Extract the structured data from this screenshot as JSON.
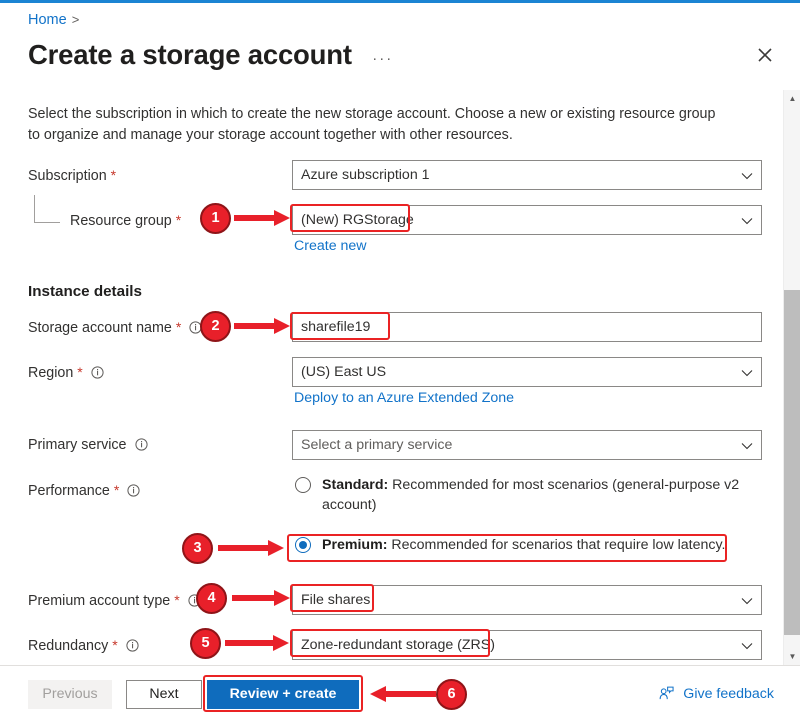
{
  "accent": {
    "blue": "#0f6cbd",
    "link": "#1273c9",
    "red": "#ea2324",
    "required": "#c6372b"
  },
  "breadcrumb": {
    "home": "Home",
    "separator": ">"
  },
  "header": {
    "title": "Create a storage account",
    "more_label": "···",
    "close_icon": "close-icon"
  },
  "description": "Select the subscription in which to create the new storage account. Choose a new or existing resource group to organize and manage your storage account together with other resources.",
  "form": {
    "subscription": {
      "label": "Subscription",
      "required": "*",
      "value": "Azure subscription 1"
    },
    "resource_group": {
      "label": "Resource group",
      "required": "*",
      "value": "(New) RGStorage",
      "create_new_link": "Create new"
    },
    "section_instance_details": "Instance details",
    "storage_account_name": {
      "label": "Storage account name",
      "required": "*",
      "value": "sharefile19"
    },
    "region": {
      "label": "Region",
      "required": "*",
      "value": "(US) East US",
      "extended_zone_link": "Deploy to an Azure Extended Zone"
    },
    "primary_service": {
      "label": "Primary service",
      "placeholder": "Select a primary service",
      "value": "Select a primary service"
    },
    "performance": {
      "label": "Performance",
      "required": "*",
      "options": [
        {
          "name": "Standard",
          "bold": "Standard:",
          "text": " Recommended for most scenarios (general-purpose v2 account)",
          "selected": false
        },
        {
          "name": "Premium",
          "bold": "Premium:",
          "text": " Recommended for scenarios that require low latency.",
          "selected": true
        }
      ]
    },
    "premium_account_type": {
      "label": "Premium account type",
      "required": "*",
      "value": "File shares"
    },
    "redundancy": {
      "label": "Redundancy",
      "required": "*",
      "value": "Zone-redundant storage (ZRS)"
    }
  },
  "footer": {
    "previous": "Previous",
    "next": "Next",
    "review_create": "Review + create",
    "give_feedback": "Give feedback"
  },
  "annotations": [
    {
      "number": "1",
      "target": "resource-group-field"
    },
    {
      "number": "2",
      "target": "storage-account-name-field"
    },
    {
      "number": "3",
      "target": "performance-premium-option"
    },
    {
      "number": "4",
      "target": "premium-account-type-field"
    },
    {
      "number": "5",
      "target": "redundancy-field"
    },
    {
      "number": "6",
      "target": "review-create-button"
    }
  ]
}
